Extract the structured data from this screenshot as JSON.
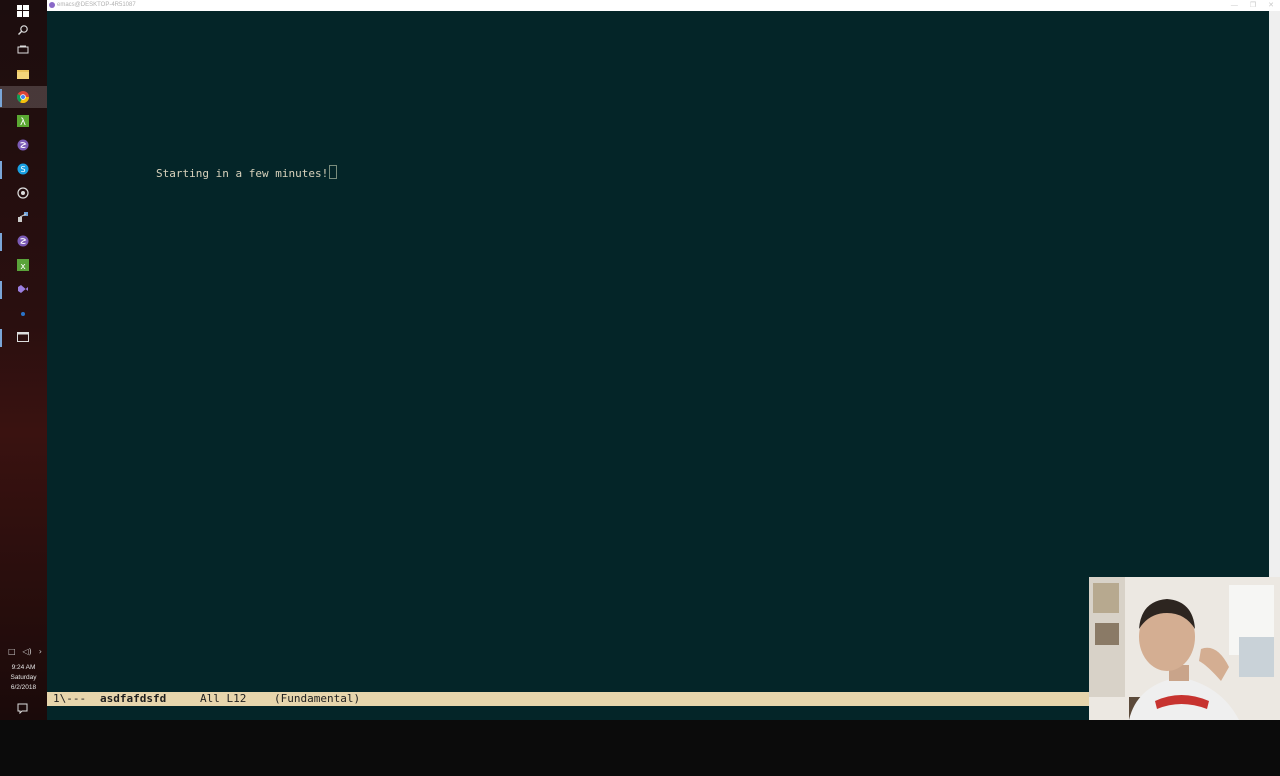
{
  "window": {
    "title": "emacs@DESKTOP-4R51087",
    "controls": [
      "—",
      "❐",
      "✕"
    ]
  },
  "taskbar": {
    "icons": [
      {
        "name": "windows-start-icon",
        "glyph": "⊞"
      },
      {
        "name": "search-icon",
        "glyph": "⌕"
      },
      {
        "name": "task-view-icon",
        "glyph": "▭"
      },
      {
        "name": "file-explorer-icon",
        "glyph": "▬"
      },
      {
        "name": "chrome-icon",
        "glyph": "◉"
      },
      {
        "name": "lambda-icon",
        "glyph": "λ"
      },
      {
        "name": "emacs-icon",
        "glyph": "●"
      },
      {
        "name": "skype-icon",
        "glyph": "●"
      },
      {
        "name": "github-icon",
        "glyph": "◎"
      },
      {
        "name": "network-icon",
        "glyph": "⚙"
      },
      {
        "name": "emacs-icon-2",
        "glyph": "●"
      },
      {
        "name": "excel-icon",
        "glyph": "■"
      },
      {
        "name": "visual-studio-icon",
        "glyph": "◆"
      },
      {
        "name": "edge-icon",
        "glyph": "e"
      },
      {
        "name": "window-icon",
        "glyph": "▭"
      }
    ],
    "tray": {
      "icons": [
        "□",
        "◁)",
        "›"
      ],
      "time": "9:24 AM",
      "day": "Saturday",
      "date": "6/2/2018"
    }
  },
  "editor": {
    "text": "Starting in a few minutes!"
  },
  "modeline": {
    "status": "1\\---",
    "buffer": "asdfafdsfd",
    "position": "All L12",
    "mode": "(Fundamental)"
  },
  "colors": {
    "background": "#042528",
    "text": "#d9d2bc",
    "modeline": "#e7d5ac"
  }
}
